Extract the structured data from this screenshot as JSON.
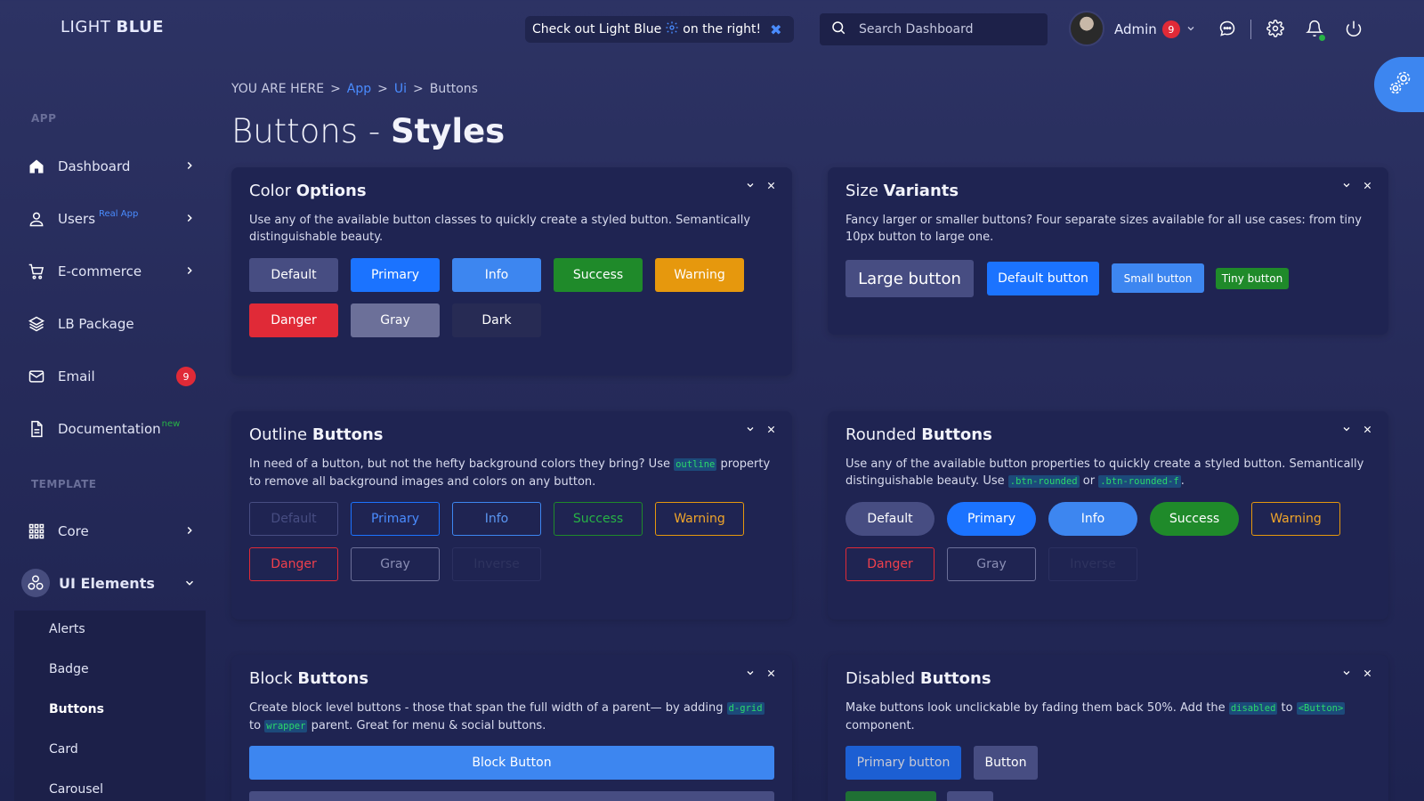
{
  "brand": {
    "light": "LIGHT ",
    "bold": "BLUE"
  },
  "header": {
    "promo_before": "Check out Light Blue",
    "promo_after": "on the right!",
    "search_placeholder": "Search Dashboard",
    "user_name": "Admin",
    "user_badge": "9"
  },
  "sidebar": {
    "section_app": "APP",
    "section_template": "TEMPLATE",
    "items": {
      "dashboard": "Dashboard",
      "users": "Users",
      "users_tag": "Real App",
      "ecommerce": "E-commerce",
      "lb_package": "LB Package",
      "email": "Email",
      "email_count": "9",
      "documentation": "Documentation",
      "documentation_tag": "new",
      "core": "Core",
      "ui_elements": "UI Elements"
    },
    "submenu": [
      "Alerts",
      "Badge",
      "Buttons",
      "Card",
      "Carousel"
    ]
  },
  "breadcrumb": {
    "prefix": "YOU ARE HERE",
    "sep": ">",
    "app": "App",
    "ui": "Ui",
    "current": "Buttons"
  },
  "page_title": {
    "light": "Buttons - ",
    "bold": "Styles"
  },
  "cards": {
    "color": {
      "title_light": "Color ",
      "title_bold": "Options",
      "desc": "Use any of the available button classes to quickly create a styled button. Semantically distinguishable beauty.",
      "buttons": [
        "Default",
        "Primary",
        "Info",
        "Success",
        "Warning",
        "Danger",
        "Gray",
        "Dark"
      ]
    },
    "size": {
      "title_light": "Size ",
      "title_bold": "Variants",
      "desc": "Fancy larger or smaller buttons? Four separate sizes available for all use cases: from tiny 10px button to large one.",
      "large": "Large button",
      "default": "Default button",
      "small": "Small button",
      "tiny": "Tiny button"
    },
    "outline": {
      "title_light": "Outline ",
      "title_bold": "Buttons",
      "desc_1": "In need of a button, but not the hefty background colors they bring? Use",
      "code": "outline",
      "desc_2": "property to remove all background images and colors on any button.",
      "buttons": [
        "Default",
        "Primary",
        "Info",
        "Success",
        "Warning",
        "Danger",
        "Gray",
        "Inverse"
      ]
    },
    "rounded": {
      "title_light": "Rounded ",
      "title_bold": "Buttons",
      "desc_1": "Use any of the available button properties to quickly create a styled button. Semantically distinguishable beauty. Use",
      "code_1": ".btn-rounded",
      "desc_or": "or",
      "code_2": ".btn-rounded-f",
      "desc_end": ".",
      "buttons": [
        "Default",
        "Primary",
        "Info",
        "Success",
        "Warning",
        "Danger",
        "Gray",
        "Inverse"
      ]
    },
    "block": {
      "title_light": "Block ",
      "title_bold": "Buttons",
      "desc_1": "Create block level buttons - those that span the full width of a parent— by adding",
      "code_1": "d-grid",
      "desc_to": "to",
      "code_2": "wrapper",
      "desc_2": "parent. Great for menu & social buttons.",
      "block_label": "Block Button"
    },
    "disabled": {
      "title_light": "Disabled ",
      "title_bold": "Buttons",
      "desc_1": "Make buttons look unclickable by fading them back 50%. Add the",
      "code_1": "disabled",
      "desc_to": "to",
      "code_2": "<Button>",
      "desc_2": "component.",
      "primary": "Primary button",
      "button": "Button"
    }
  },
  "colors": {
    "accent": "#3d86f0",
    "primary": "#1b73ff",
    "success": "#1f8a2a",
    "warning": "#e6980d",
    "danger": "#e02a37"
  }
}
